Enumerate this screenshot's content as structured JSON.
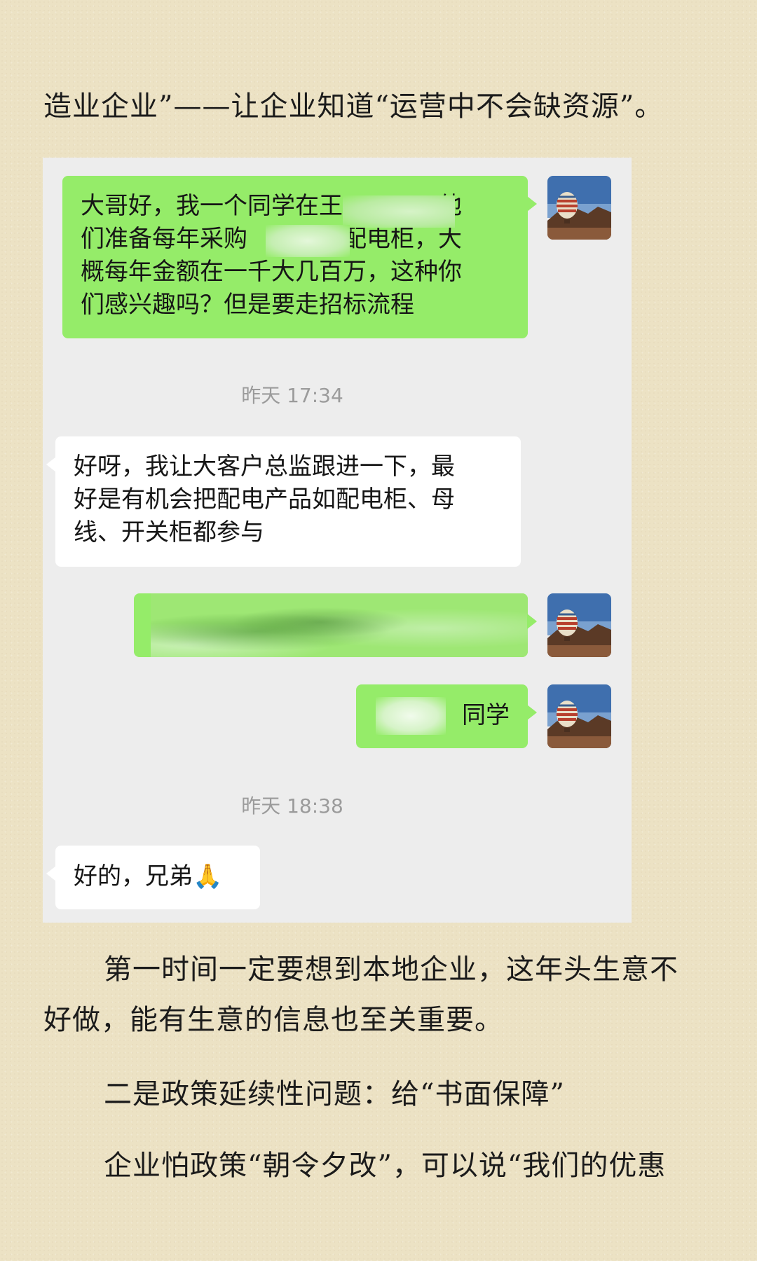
{
  "article": {
    "para_top": "造业企业”——让企业知道“运营中不会缺资源”。",
    "para_1_line_1": "第一时间一定要想到本地企业，这年头生意不",
    "para_1_line_2": "好做，能有生意的信息也至关重要。",
    "para_2": "二是政策延续性问题：给“书面保障”",
    "para_3": "企业怕政策“朝令夕改”，可以说“我们的优惠"
  },
  "chat": {
    "messages": [
      {
        "sender": "me",
        "text": "大哥好，我一个同学在王　　　，他\n们准备每年采购　　　个配电柜，大\n概每年金额在一千大几百万，这种你\n们感兴趣吗？但是要走招标流程"
      },
      {
        "sender": "other",
        "text": "好呀，我让大客户总监跟进一下，最\n好是有机会把配电产品如配电柜、母\n线、开关柜都参与"
      },
      {
        "sender": "me",
        "text": ""
      },
      {
        "sender": "me",
        "text": "同学"
      },
      {
        "sender": "other",
        "text": "好的，兄弟🙏"
      }
    ],
    "timestamps": [
      "昨天 17:34",
      "昨天 18:38"
    ],
    "avatar_icon": "hot-air-balloon-avatar-icon",
    "colors": {
      "my_bubble": "#95ec69",
      "other_bubble": "#ffffff",
      "chat_background": "#ededed",
      "page_background": "#ece2c4"
    }
  }
}
